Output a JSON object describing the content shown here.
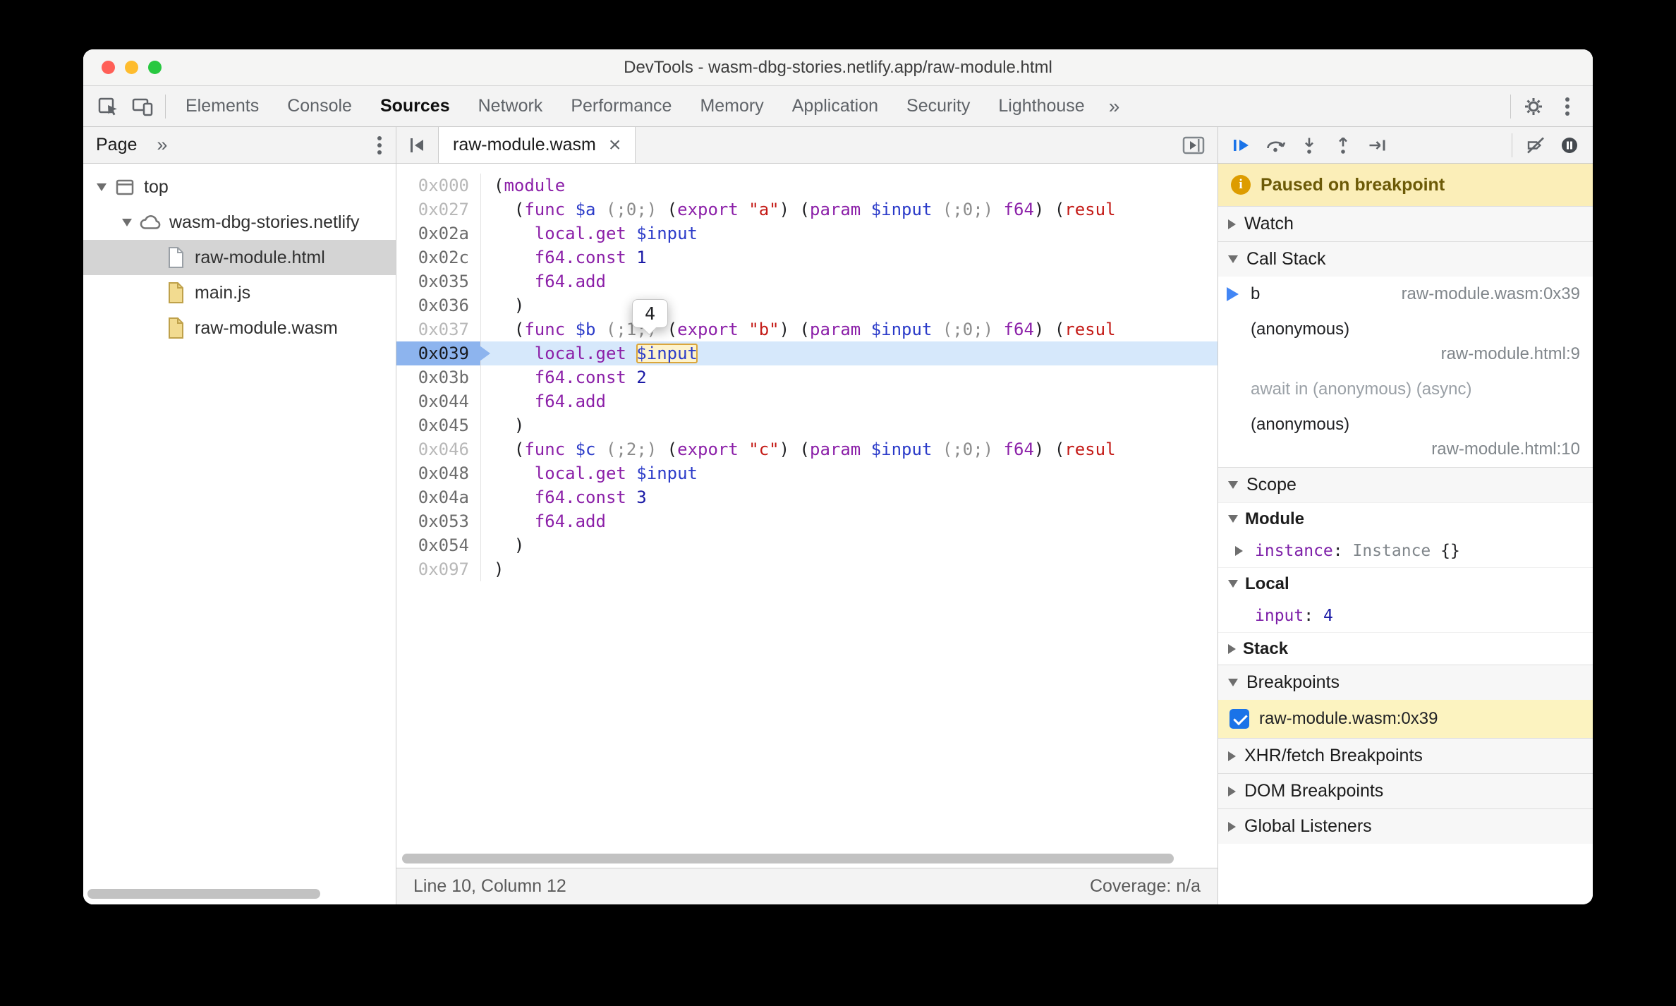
{
  "colors": {
    "accent_blue": "#1a73e8",
    "paused_banner_bg": "#fbeeb8",
    "breakpoint_row_bg": "#fcf3c0",
    "paused_line_bg": "#d6e8fb",
    "paused_gutter_bg": "#8db4ee",
    "selected_file_bg": "#d4d4d4",
    "traffic_close": "#ff5f57",
    "traffic_minimize": "#febc2e",
    "traffic_zoom": "#28c840"
  },
  "titlebar": {
    "title": "DevTools - wasm-dbg-stories.netlify.app/raw-module.html"
  },
  "main_toolbar": {
    "inspect_icon": "inspect-cursor-icon",
    "device_icon": "device-toolbar-icon",
    "tabs": [
      {
        "label": "Elements",
        "active": false
      },
      {
        "label": "Console",
        "active": false
      },
      {
        "label": "Sources",
        "active": true
      },
      {
        "label": "Network",
        "active": false
      },
      {
        "label": "Performance",
        "active": false
      },
      {
        "label": "Memory",
        "active": false
      },
      {
        "label": "Application",
        "active": false
      },
      {
        "label": "Security",
        "active": false
      },
      {
        "label": "Lighthouse",
        "active": false
      }
    ],
    "overflow": "»",
    "gear_icon": "settings-gear-icon",
    "menu_icon": "kebab-menu-icon"
  },
  "navigator": {
    "tab": "Page",
    "overflow": "»",
    "menu_icon": "kebab-menu-icon",
    "tree": [
      {
        "label": "top",
        "icon": "frame",
        "level": 0,
        "expanded": true
      },
      {
        "label": "wasm-dbg-stories.netlify",
        "icon": "cloud",
        "level": 1,
        "expanded": true
      },
      {
        "label": "raw-module.html",
        "icon": "document",
        "level": 2,
        "selected": true
      },
      {
        "label": "main.js",
        "icon": "script",
        "level": 2
      },
      {
        "label": "raw-module.wasm",
        "icon": "script",
        "level": 2
      }
    ]
  },
  "editor": {
    "hide_navigator_icon": "panel-left-collapse-icon",
    "panel_icon": "panel-open-right-icon",
    "tab": {
      "label": "raw-module.wasm",
      "close_icon": "×"
    },
    "tooltip": {
      "value": "4"
    },
    "status": {
      "left": "Line 10, Column 12",
      "right": "Coverage: n/a"
    },
    "lines": [
      {
        "addr": "0x000",
        "dim": true,
        "tokens": [
          [
            "(",
            "p"
          ],
          [
            "module",
            "k"
          ]
        ]
      },
      {
        "addr": "0x027",
        "dim": true,
        "tokens": [
          [
            "  (",
            "p"
          ],
          [
            "func",
            "k"
          ],
          [
            " ",
            "p"
          ],
          [
            "$a",
            "v"
          ],
          [
            " ",
            "p"
          ],
          [
            "(;0;)",
            "c"
          ],
          [
            " (",
            "p"
          ],
          [
            "export",
            "k"
          ],
          [
            " ",
            "p"
          ],
          [
            "\"a\"",
            "s"
          ],
          [
            ") (",
            "p"
          ],
          [
            "param",
            "k"
          ],
          [
            " ",
            "p"
          ],
          [
            "$input",
            "v"
          ],
          [
            " ",
            "p"
          ],
          [
            "(;0;)",
            "c"
          ],
          [
            " ",
            "p"
          ],
          [
            "f64",
            "k"
          ],
          [
            ") (",
            "p"
          ],
          [
            "resul",
            "s"
          ]
        ]
      },
      {
        "addr": "0x02a",
        "tokens": [
          [
            "    ",
            "p"
          ],
          [
            "local.get",
            "k"
          ],
          [
            " ",
            "p"
          ],
          [
            "$input",
            "v"
          ]
        ]
      },
      {
        "addr": "0x02c",
        "tokens": [
          [
            "    ",
            "p"
          ],
          [
            "f64.const",
            "k"
          ],
          [
            " ",
            "p"
          ],
          [
            "1",
            "n"
          ]
        ]
      },
      {
        "addr": "0x035",
        "tokens": [
          [
            "    ",
            "p"
          ],
          [
            "f64.add",
            "k"
          ]
        ]
      },
      {
        "addr": "0x036",
        "tokens": [
          [
            "  )",
            "p"
          ]
        ]
      },
      {
        "addr": "0x037",
        "dim": true,
        "tokens": [
          [
            "  (",
            "p"
          ],
          [
            "func",
            "k"
          ],
          [
            " ",
            "p"
          ],
          [
            "$b",
            "v"
          ],
          [
            " ",
            "p"
          ],
          [
            "(;1;)",
            "c"
          ],
          [
            " (",
            "p"
          ],
          [
            "export",
            "k"
          ],
          [
            " ",
            "p"
          ],
          [
            "\"b\"",
            "s"
          ],
          [
            ") (",
            "p"
          ],
          [
            "param",
            "k"
          ],
          [
            " ",
            "p"
          ],
          [
            "$input",
            "v"
          ],
          [
            " ",
            "p"
          ],
          [
            "(;0;)",
            "c"
          ],
          [
            " ",
            "p"
          ],
          [
            "f64",
            "k"
          ],
          [
            ") (",
            "p"
          ],
          [
            "resul",
            "s"
          ]
        ]
      },
      {
        "addr": "0x039",
        "paused": true,
        "tokens": [
          [
            "    ",
            "p"
          ],
          [
            "local.get",
            "k"
          ],
          [
            " ",
            "p"
          ],
          [
            "$input",
            "v",
            "eval"
          ]
        ]
      },
      {
        "addr": "0x03b",
        "tokens": [
          [
            "    ",
            "p"
          ],
          [
            "f64.const",
            "k"
          ],
          [
            " ",
            "p"
          ],
          [
            "2",
            "n"
          ]
        ]
      },
      {
        "addr": "0x044",
        "tokens": [
          [
            "    ",
            "p"
          ],
          [
            "f64.add",
            "k"
          ]
        ]
      },
      {
        "addr": "0x045",
        "tokens": [
          [
            "  )",
            "p"
          ]
        ]
      },
      {
        "addr": "0x046",
        "dim": true,
        "tokens": [
          [
            "  (",
            "p"
          ],
          [
            "func",
            "k"
          ],
          [
            " ",
            "p"
          ],
          [
            "$c",
            "v"
          ],
          [
            " ",
            "p"
          ],
          [
            "(;2;)",
            "c"
          ],
          [
            " (",
            "p"
          ],
          [
            "export",
            "k"
          ],
          [
            " ",
            "p"
          ],
          [
            "\"c\"",
            "s"
          ],
          [
            ") (",
            "p"
          ],
          [
            "param",
            "k"
          ],
          [
            " ",
            "p"
          ],
          [
            "$input",
            "v"
          ],
          [
            " ",
            "p"
          ],
          [
            "(;0;)",
            "c"
          ],
          [
            " ",
            "p"
          ],
          [
            "f64",
            "k"
          ],
          [
            ") (",
            "p"
          ],
          [
            "resul",
            "s"
          ]
        ]
      },
      {
        "addr": "0x048",
        "tokens": [
          [
            "    ",
            "p"
          ],
          [
            "local.get",
            "k"
          ],
          [
            " ",
            "p"
          ],
          [
            "$input",
            "v"
          ]
        ]
      },
      {
        "addr": "0x04a",
        "tokens": [
          [
            "    ",
            "p"
          ],
          [
            "f64.const",
            "k"
          ],
          [
            " ",
            "p"
          ],
          [
            "3",
            "n"
          ]
        ]
      },
      {
        "addr": "0x053",
        "tokens": [
          [
            "    ",
            "p"
          ],
          [
            "f64.add",
            "k"
          ]
        ]
      },
      {
        "addr": "0x054",
        "tokens": [
          [
            "  )",
            "p"
          ]
        ]
      },
      {
        "addr": "0x097",
        "dim": true,
        "tokens": [
          [
            ")",
            "p"
          ]
        ]
      }
    ]
  },
  "debugger": {
    "toolbar_icons": [
      "resume",
      "step-over",
      "step-into",
      "step-out",
      "step",
      "deactivate-breakpoints",
      "pause-on-exceptions"
    ],
    "paused_message": "Paused on breakpoint",
    "watch": {
      "title": "Watch",
      "expanded": false
    },
    "call_stack": {
      "title": "Call Stack",
      "expanded": true,
      "frames": [
        {
          "kind": "frame",
          "name": "b",
          "location": "raw-module.wasm:0x39",
          "current": true,
          "wrap": false
        },
        {
          "kind": "frame",
          "name": "(anonymous)",
          "location": "raw-module.html:9",
          "wrap": true
        },
        {
          "kind": "async",
          "label": "await in (anonymous) (async)"
        },
        {
          "kind": "frame",
          "name": "(anonymous)",
          "location": "raw-module.html:10",
          "wrap": true
        }
      ]
    },
    "scope": {
      "title": "Scope",
      "expanded": true,
      "groups": [
        {
          "name": "Module",
          "expanded": true,
          "props": [
            {
              "name": "instance",
              "expandable": true,
              "value_parts": [
                {
                  "text": "Instance",
                  "cls": "obj-class"
                },
                {
                  "text": " {}",
                  "cls": "obj-plain"
                }
              ]
            }
          ]
        },
        {
          "name": "Local",
          "expanded": true,
          "props": [
            {
              "name": "input",
              "expandable": false,
              "value_parts": [
                {
                  "text": "4",
                  "cls": "num"
                }
              ]
            }
          ]
        },
        {
          "name": "Stack",
          "expanded": false,
          "props": []
        }
      ]
    },
    "breakpoints": {
      "title": "Breakpoints",
      "expanded": true,
      "items": [
        {
          "label": "raw-module.wasm:0x39",
          "checked": true,
          "highlighted": true
        }
      ]
    },
    "more_sections": [
      {
        "title": "XHR/fetch Breakpoints"
      },
      {
        "title": "DOM Breakpoints"
      },
      {
        "title": "Global Listeners"
      }
    ]
  }
}
